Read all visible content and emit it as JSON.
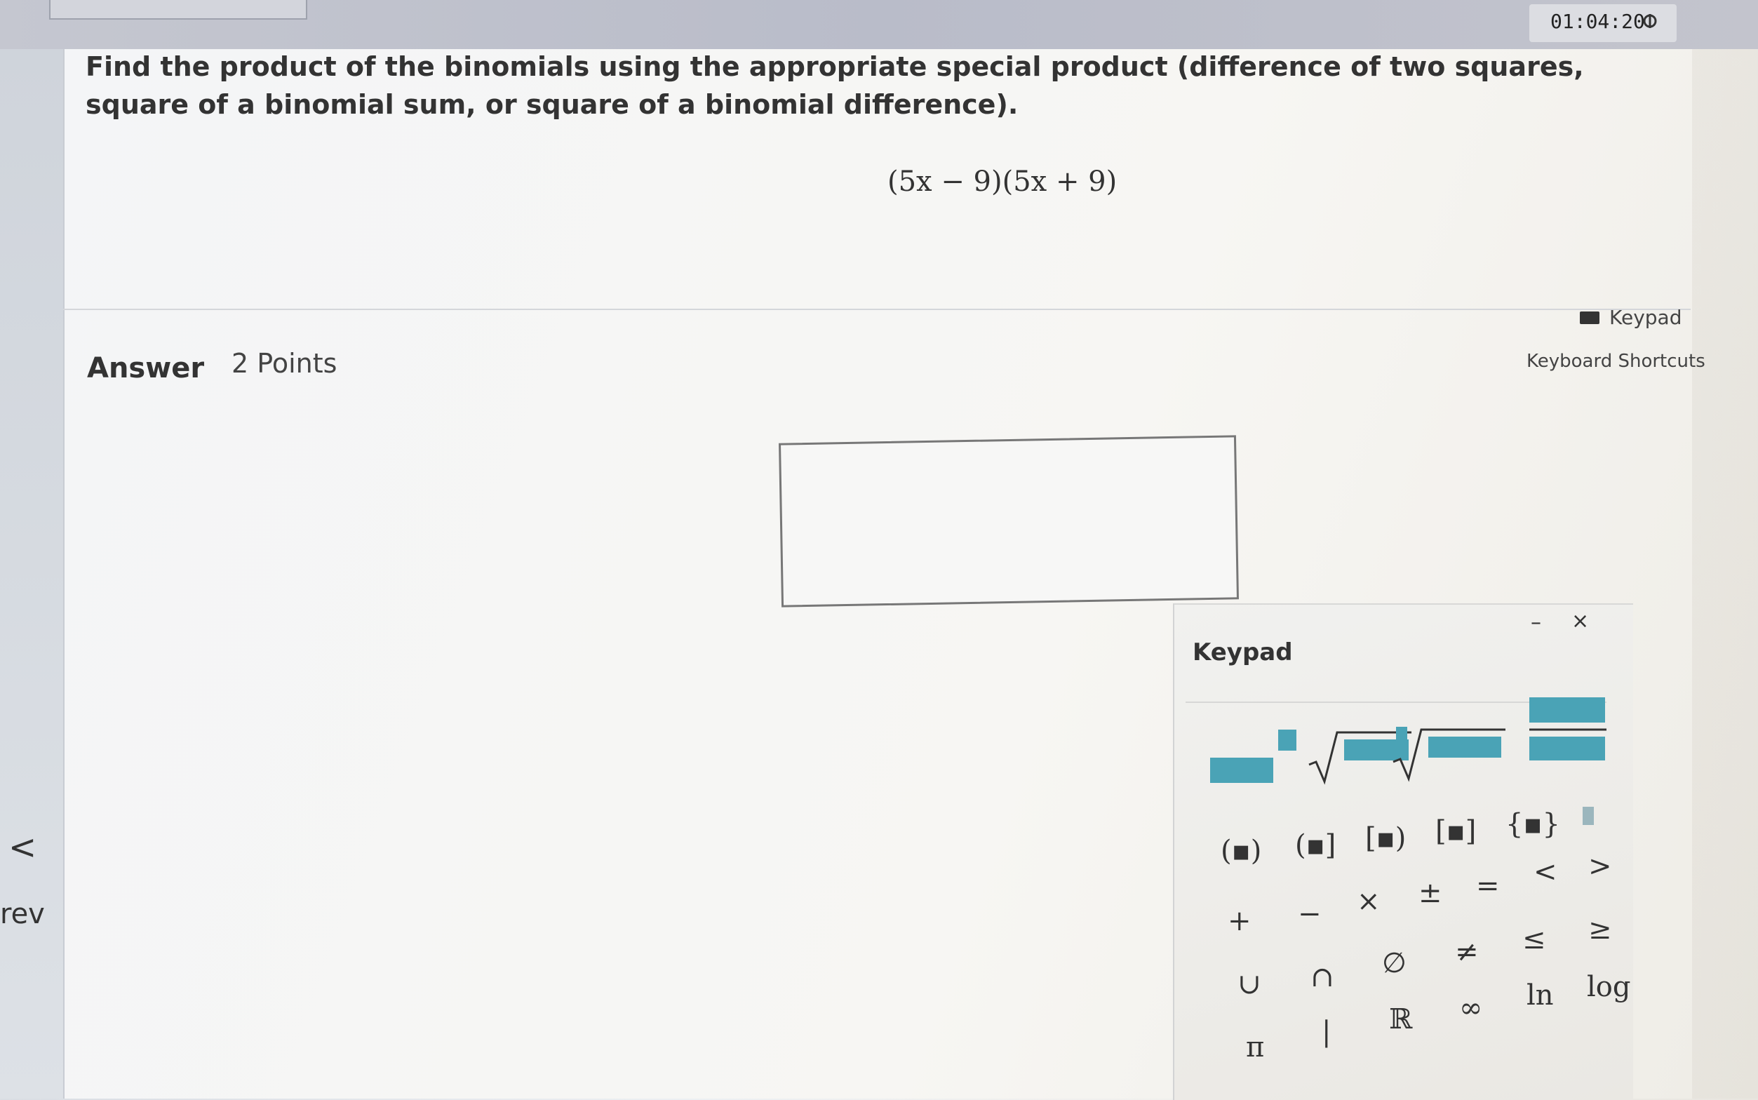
{
  "timer": "01:04:20",
  "question": "Find the product of the binomials using the appropriate special product (difference of two squares, square of a binomial sum, or square of a binomial difference).",
  "expression": "(5x − 9)(5x + 9)",
  "answer_label": "Answer",
  "points": "2 Points",
  "keypad_link": "Keypad",
  "shortcuts": "Keyboard Shortcuts",
  "nav": {
    "prev": "rev",
    "chevron": "<"
  },
  "keypad": {
    "title": "Keypad",
    "minimize": "–",
    "close": "×",
    "row2": [
      "(▪)",
      "(▪]",
      "[▪)",
      "[▪]",
      "{▪}"
    ],
    "row3": [
      "+",
      "−",
      "×",
      "±",
      "=",
      "<",
      ">"
    ],
    "row4": [
      "∪",
      "∩",
      "∅",
      "≠",
      "≤",
      "≥"
    ],
    "row5": [
      "π",
      "|",
      "ℝ",
      "∞",
      "ln",
      "log"
    ]
  },
  "colors": {
    "accent": "#4aa3b6"
  }
}
